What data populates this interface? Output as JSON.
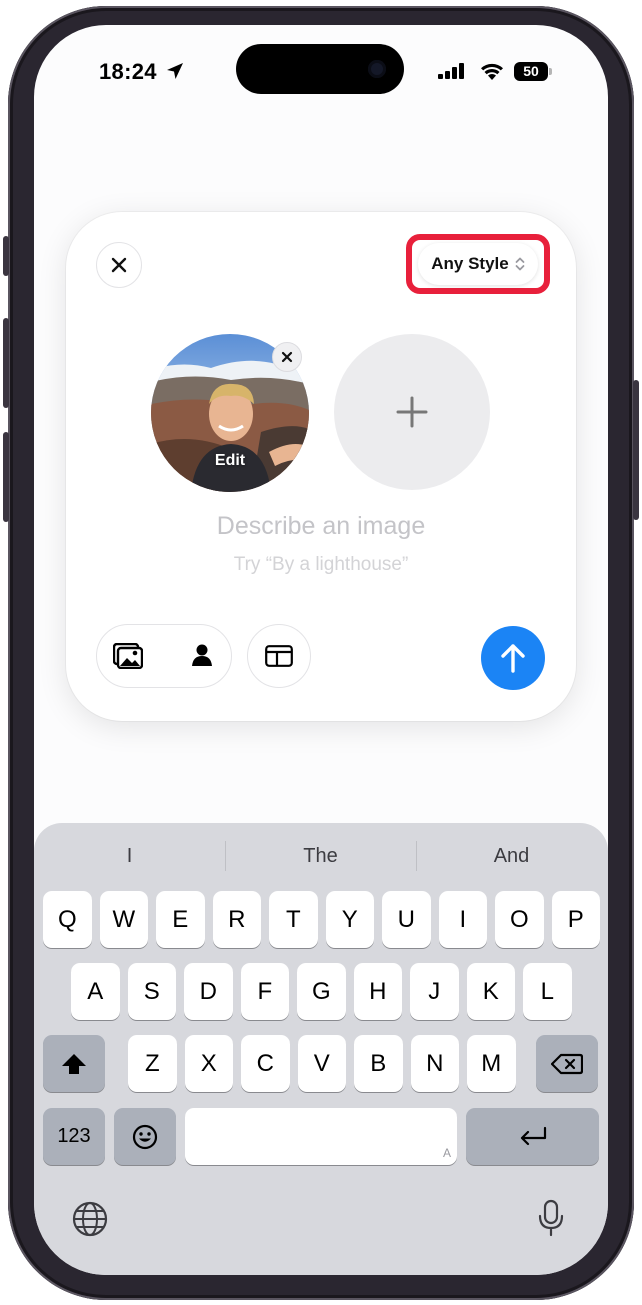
{
  "status": {
    "time": "18:24",
    "battery": "50"
  },
  "card": {
    "style_picker": "Any Style",
    "photo_edit_label": "Edit",
    "prompt_placeholder": "Describe an image",
    "prompt_hint": "Try “By a lighthouse”"
  },
  "keyboard": {
    "suggestions": [
      "I",
      "The",
      "And"
    ],
    "row1": [
      "Q",
      "W",
      "E",
      "R",
      "T",
      "Y",
      "U",
      "I",
      "O",
      "P"
    ],
    "row2": [
      "A",
      "S",
      "D",
      "F",
      "G",
      "H",
      "J",
      "K",
      "L"
    ],
    "row3": [
      "Z",
      "X",
      "C",
      "V",
      "B",
      "N",
      "M"
    ],
    "numbers_label": "123",
    "space_hint": "A"
  },
  "colors": {
    "accent": "#1b84f5",
    "highlight": "#e8203b"
  },
  "icons": [
    "location-arrow-icon",
    "signal-icon",
    "wifi-icon",
    "battery-icon",
    "close-icon",
    "chevron-updown-icon",
    "remove-icon",
    "plus-icon",
    "photos-icon",
    "person-icon",
    "layout-icon",
    "arrow-up-icon",
    "shift-icon",
    "delete-icon",
    "emoji-icon",
    "return-icon",
    "globe-icon",
    "microphone-icon"
  ]
}
